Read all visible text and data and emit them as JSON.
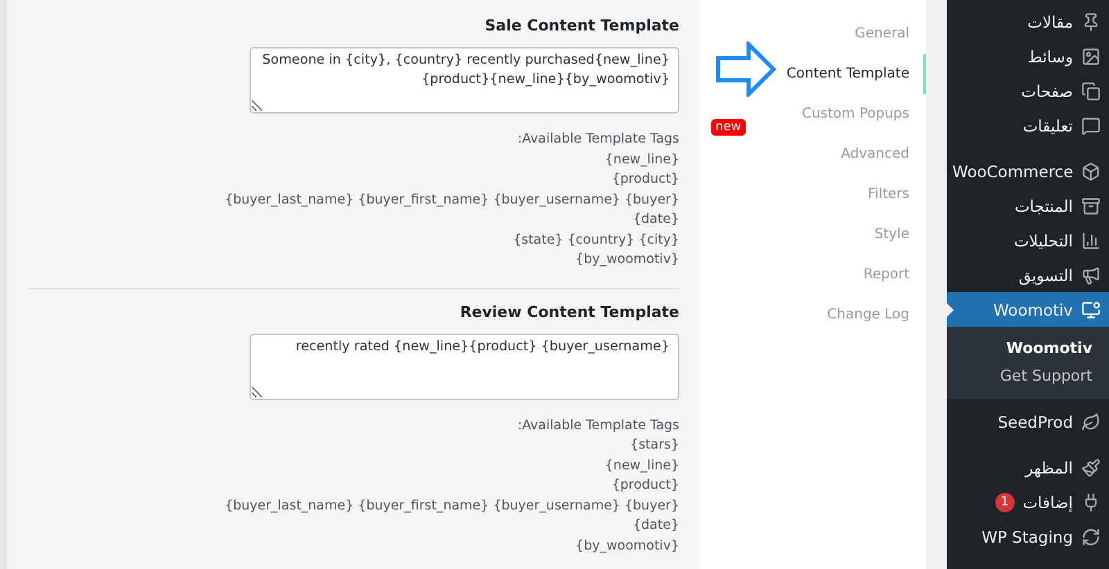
{
  "admin_menu": [
    {
      "label": "مقالات",
      "selected": false
    },
    {
      "label": "وسائط",
      "selected": false
    },
    {
      "label": "صفحات",
      "selected": false
    },
    {
      "label": "تعليقات",
      "selected": false
    },
    {
      "label": "WooCommerce",
      "selected": false
    },
    {
      "label": "المنتجات",
      "selected": false
    },
    {
      "label": "التحليلات",
      "selected": false
    },
    {
      "label": "التسويق",
      "selected": false
    },
    {
      "label": "Woomotiv",
      "selected": true,
      "submenu": [
        {
          "label": "Woomotiv",
          "selected": true
        },
        {
          "label": "Get Support",
          "selected": false
        }
      ]
    },
    {
      "label": "SeedProd",
      "selected": false
    },
    {
      "label": "المظهر",
      "selected": false
    },
    {
      "label": "إضافات",
      "selected": false,
      "badge": "1"
    },
    {
      "label": "WP Staging",
      "selected": false
    }
  ],
  "settings_nav": [
    {
      "label": "General",
      "selected": false
    },
    {
      "label": "Content Template",
      "selected": true
    },
    {
      "label": "Custom Popups",
      "selected": false,
      "badge": "new"
    },
    {
      "label": "Advanced",
      "selected": false
    },
    {
      "label": "Filters",
      "selected": false
    },
    {
      "label": "Style",
      "selected": false
    },
    {
      "label": "Report",
      "selected": false
    },
    {
      "label": "Change Log",
      "selected": false
    }
  ],
  "sections": [
    {
      "title": "Sale Content Template",
      "value": "Someone in {city}, {country} recently purchased{new_line}{product}{new_line}{by_woomotiv}",
      "tags_label": "Available Template Tags:",
      "tags": [
        "{new_line}",
        "{product}",
        "{buyer_last_name} {buyer_first_name} {buyer_username} {buyer}",
        "{date}",
        "{state} {country} {city}",
        "{by_woomotiv}"
      ]
    },
    {
      "title": "Review Content Template",
      "value": "recently rated {new_line}{product} {buyer_username}",
      "tags_label": "Available Template Tags:",
      "tags": [
        "{stars}",
        "{new_line}",
        "{product}",
        "{buyer_last_name} {buyer_first_name} {buyer_username} {buyer}",
        "{date}",
        "{by_woomotiv}"
      ]
    }
  ]
}
